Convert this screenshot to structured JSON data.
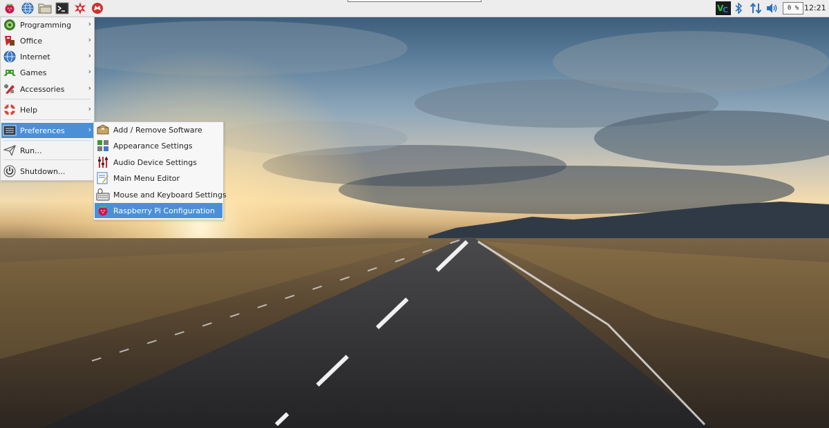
{
  "panel": {
    "launchers": [
      {
        "name": "raspberry-menu-icon"
      },
      {
        "name": "web-browser-icon"
      },
      {
        "name": "file-manager-icon"
      },
      {
        "name": "terminal-icon"
      },
      {
        "name": "mathematica-icon"
      },
      {
        "name": "wolfram-icon"
      }
    ],
    "tray": {
      "vnc_icon": "vnc-icon",
      "bluetooth_icon": "bluetooth-icon",
      "network_icon": "network-arrows-icon",
      "volume_icon": "volume-icon",
      "cpu_usage": "0 %",
      "clock": "12:21"
    }
  },
  "main_menu": {
    "items": [
      {
        "label": "Programming",
        "icon": "programming-icon",
        "has_submenu": true
      },
      {
        "label": "Office",
        "icon": "office-icon",
        "has_submenu": true
      },
      {
        "label": "Internet",
        "icon": "internet-globe-icon",
        "has_submenu": true
      },
      {
        "label": "Games",
        "icon": "games-icon",
        "has_submenu": true
      },
      {
        "label": "Accessories",
        "icon": "accessories-icon",
        "has_submenu": true
      },
      {
        "label": "Help",
        "icon": "help-lifebuoy-icon",
        "has_submenu": true
      },
      {
        "label": "Preferences",
        "icon": "preferences-icon",
        "has_submenu": true,
        "selected": true
      },
      {
        "label": "Run...",
        "icon": "run-icon",
        "has_submenu": false
      },
      {
        "label": "Shutdown...",
        "icon": "shutdown-icon",
        "has_submenu": false
      }
    ],
    "arrow_glyph": "›"
  },
  "preferences_submenu": {
    "items": [
      {
        "label": "Add / Remove Software",
        "icon": "package-icon"
      },
      {
        "label": "Appearance Settings",
        "icon": "appearance-icon"
      },
      {
        "label": "Audio Device Settings",
        "icon": "audio-mixer-icon"
      },
      {
        "label": "Main Menu Editor",
        "icon": "menu-editor-icon"
      },
      {
        "label": "Mouse and Keyboard Settings",
        "icon": "keyboard-mouse-icon"
      },
      {
        "label": "Raspberry Pi Configuration",
        "icon": "raspberry-config-icon",
        "selected": true
      }
    ]
  },
  "colors": {
    "panel_bg": "#ededed",
    "menu_bg": "#f3f3f3",
    "selection": "#4a90d9",
    "raspberry_red": "#c51a4a",
    "raspberry_green": "#6cc04a"
  }
}
